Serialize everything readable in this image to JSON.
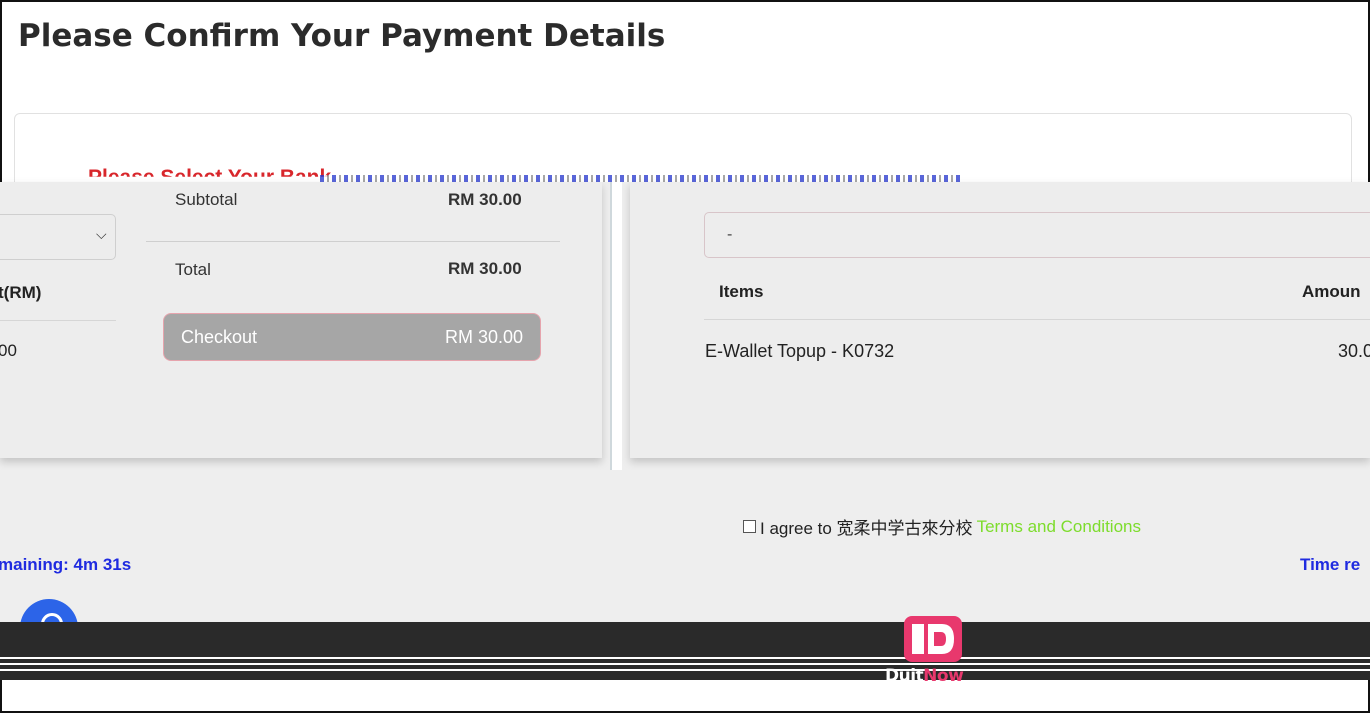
{
  "page": {
    "title": "Please Confirm Your Payment Details"
  },
  "bank_selection": {
    "heading": "Please Select Your Bank",
    "left_amount_header": "t(RM)",
    "left_amount_value": "00"
  },
  "summary": {
    "subtotal_label": "Subtotal",
    "subtotal_value": "RM 30.00",
    "total_label": "Total",
    "total_value": "RM 30.00",
    "checkout_label": "Checkout",
    "checkout_amount": "RM 30.00"
  },
  "order": {
    "select_value": "-",
    "columns": [
      "Items",
      "Amoun"
    ],
    "rows": [
      {
        "item": "E-Wallet Topup - K0732",
        "amount": "30.0"
      }
    ]
  },
  "agreement": {
    "prefix": "I agree to 宽柔中学古來分校",
    "link": "Terms and Conditions",
    "checked": false
  },
  "timer": {
    "left": "maining: 4m 31s",
    "right": "Time re"
  },
  "brand": {
    "duit": "Duit",
    "now": "Now"
  },
  "colors": {
    "accent_blue": "#1f2be0",
    "link_green": "#7ddc2c",
    "heading_red": "#d8262b",
    "duitnow_pink": "#e8386d"
  }
}
